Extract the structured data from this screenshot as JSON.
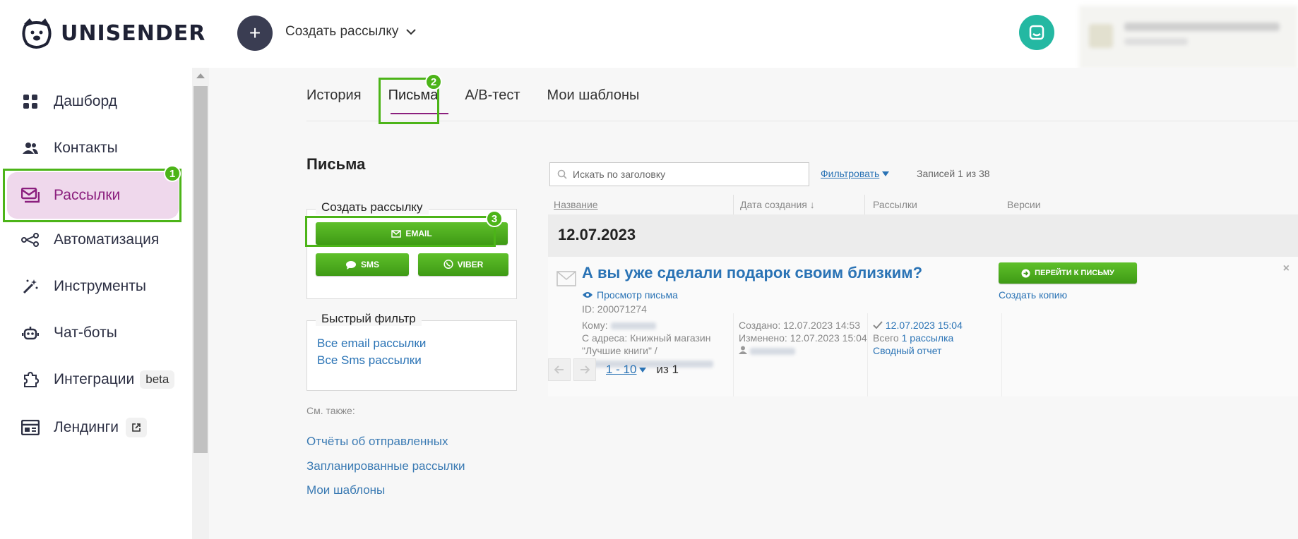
{
  "header": {
    "brand": "UNISENDER",
    "create_dropdown_label": "Создать рассылку",
    "plus_label": "+"
  },
  "sidebar": {
    "items": [
      {
        "label": "Дашборд"
      },
      {
        "label": "Контакты"
      },
      {
        "label": "Рассылки"
      },
      {
        "label": "Автоматизация"
      },
      {
        "label": "Инструменты"
      },
      {
        "label": "Чат-боты"
      },
      {
        "label": "Интеграции",
        "badge": "beta"
      },
      {
        "label": "Лендинги"
      }
    ]
  },
  "annotations": [
    "1",
    "2",
    "3"
  ],
  "tabs": [
    {
      "label": "История"
    },
    {
      "label": "Письма"
    },
    {
      "label": "A/B-тест"
    },
    {
      "label": "Мои шаблоны"
    }
  ],
  "page_title": "Письма",
  "create_panel": {
    "legend": "Создать рассылку",
    "email_label": "EMAIL",
    "sms_label": "SMS",
    "viber_label": "VIBER"
  },
  "quick_filter": {
    "legend": "Быстрый фильтр",
    "links": [
      "Все email рассылки",
      "Все Sms рассылки"
    ]
  },
  "see_also": {
    "label": "См. также:",
    "links": [
      "Отчёты об отправленных",
      "Запланированные рассылки",
      "Мои шаблоны"
    ]
  },
  "search": {
    "placeholder": "Искать по заголовку"
  },
  "filter_label": "Фильтровать",
  "records_label": "Записей 1 из 38",
  "table": {
    "headers": [
      "Название",
      "Дата создания ↓",
      "Рассылки",
      "Версии"
    ],
    "date_group": "12.07.2023",
    "letter": {
      "title": "А вы уже сделали подарок своим близким?",
      "view_link": "Просмотр письма",
      "id": "ID: 200071274",
      "to_label": "Кому:",
      "from_line1": "С адреса: Книжный магазин",
      "from_line2": "\"Лучшие книги\" /",
      "created": "Создано: 12.07.2023 14:53",
      "modified": "Изменено: 12.07.2023 15:04",
      "sent_date": "12.07.2023 15:04",
      "total_prefix": "Всего",
      "total_link": "1 рассылка",
      "report_link": "Сводный отчет",
      "goto_button": "ПЕРЕЙТИ К ПИСЬМУ",
      "copy_link": "Создать копию",
      "close": "×"
    }
  },
  "pager": {
    "range": "1 - 10",
    "of": "из 1"
  },
  "colors": {
    "accent_purple": "#8b1f7e",
    "active_bg": "#efd8ec",
    "button_green": "#4cb418",
    "link_blue": "#2a73b5",
    "chat_teal": "#24b8a2"
  }
}
